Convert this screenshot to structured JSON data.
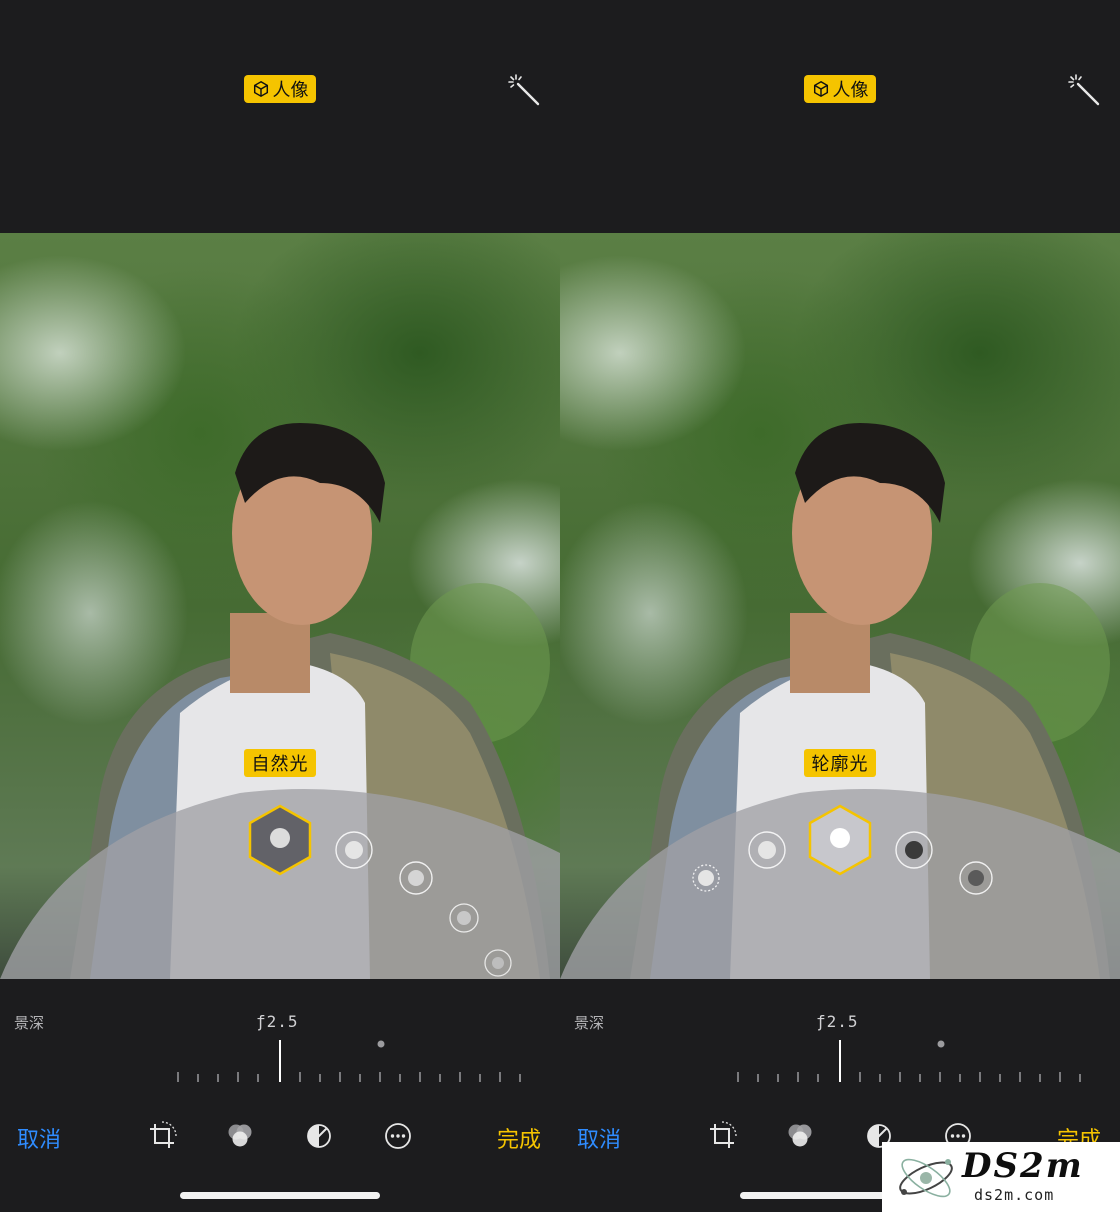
{
  "panels": [
    {
      "mode_badge": "人像",
      "lighting_label": "自然光",
      "depth_label": "景深",
      "aperture": "ƒ2.5",
      "toolbar": {
        "cancel": "取消",
        "done": "完成"
      }
    },
    {
      "mode_badge": "人像",
      "lighting_label": "轮廓光",
      "depth_label": "景深",
      "aperture": "ƒ2.5",
      "toolbar": {
        "cancel": "取消",
        "done": "完成"
      }
    }
  ],
  "icons": [
    "cube-icon",
    "magic-wand-icon",
    "crop-rotate-icon",
    "filters-icon",
    "adjust-light-icon",
    "more-icon"
  ],
  "colors": {
    "accent_yellow": "#f5c400",
    "link_blue": "#2f8cff",
    "background": "#1c1c1e"
  },
  "watermark": {
    "title": "DS2m",
    "url": "ds2m.com"
  }
}
